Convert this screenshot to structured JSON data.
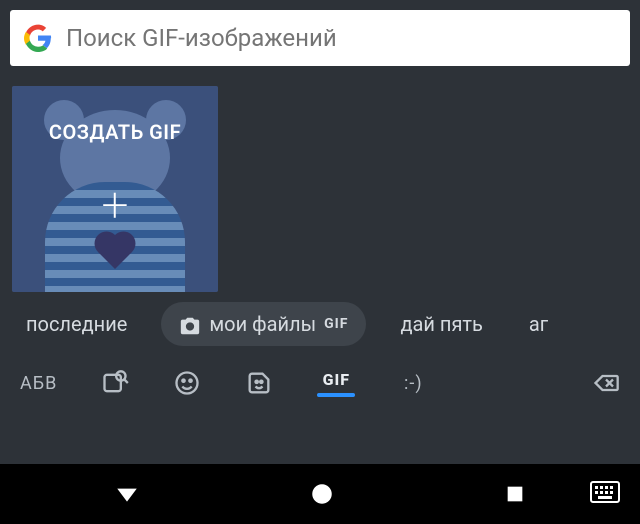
{
  "search": {
    "placeholder": "Поиск GIF-изображений"
  },
  "card": {
    "create_label": "СОЗДАТЬ GIF",
    "plus": "+"
  },
  "chips": {
    "recent": "последние",
    "my_files": "мои файлы",
    "gif_badge": "GIF",
    "highfive": "дай пять",
    "partial": "аг"
  },
  "bottom": {
    "abc": "АБВ",
    "gif_tab": "GIF",
    "emoticon": ":-)"
  }
}
